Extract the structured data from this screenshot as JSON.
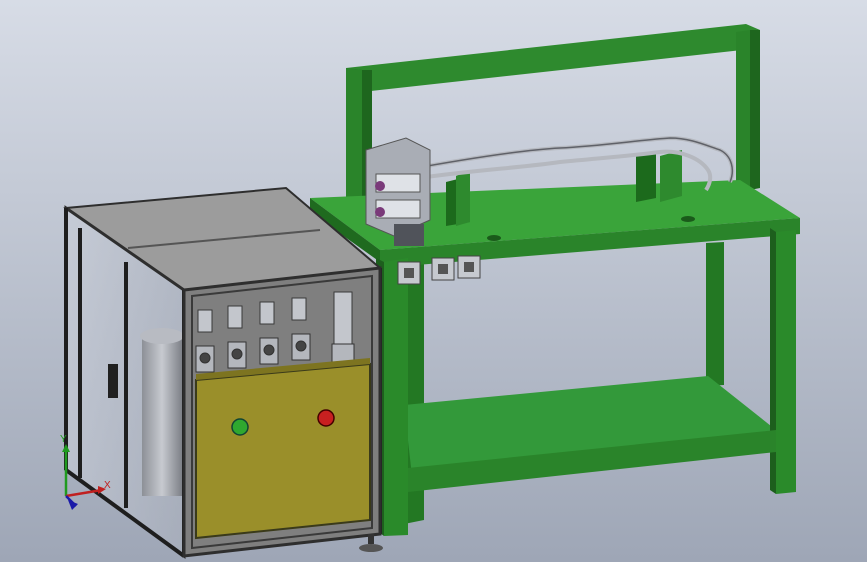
{
  "scene": {
    "background_top": "#d7dce6",
    "background_bottom": "#9ea6b6",
    "table_color": "#2f8f2f",
    "table_dark": "#1f6a1f",
    "table_top_color": "#3aa43a",
    "cabinet_frame": "#3c3c3c",
    "cabinet_panel": "#8c8c8c",
    "control_box": "#9a8f2a",
    "control_box_dark": "#7d7420",
    "button_green": "#2fa82f",
    "button_red": "#c82020"
  },
  "triad": {
    "x_label": "X",
    "y_label": "Y"
  }
}
